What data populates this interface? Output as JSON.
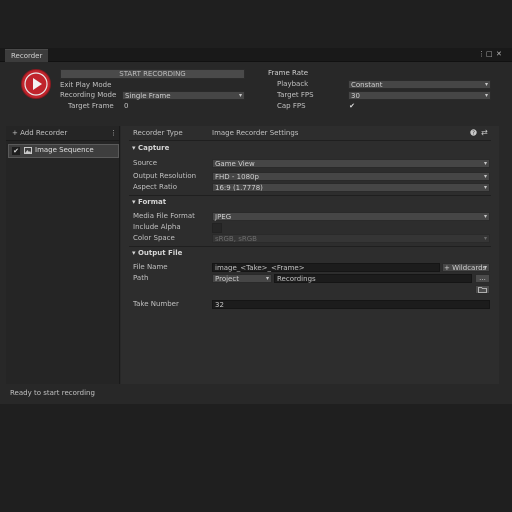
{
  "window": {
    "tab_title": "Recorder",
    "controls": {
      "more": "⋮",
      "maximize": "□",
      "close": "✕"
    }
  },
  "top": {
    "start_button": "START RECORDING",
    "exit_play_mode_label": "Exit Play Mode",
    "recording_mode_label": "Recording Mode",
    "recording_mode_value": "Single Frame",
    "target_frame_label": "Target Frame",
    "target_frame_value": "0",
    "frame_rate_title": "Frame Rate",
    "playback_label": "Playback",
    "playback_value": "Constant",
    "target_fps_label": "Target FPS",
    "target_fps_value": "30",
    "cap_fps_label": "Cap FPS",
    "cap_fps_checked": "✔"
  },
  "sidebar": {
    "add_recorder": "+ Add Recorder",
    "more": "⋮",
    "items": [
      {
        "check": "✔",
        "label": "Image Sequence"
      }
    ]
  },
  "main": {
    "recorder_type_label": "Recorder Type",
    "recorder_type_value": "Image Recorder Settings",
    "capture": {
      "title": "Capture",
      "source_label": "Source",
      "source_value": "Game View",
      "output_resolution_label": "Output Resolution",
      "output_resolution_value": "FHD - 1080p",
      "aspect_ratio_label": "Aspect Ratio",
      "aspect_ratio_value": "16:9 (1.7778)"
    },
    "format": {
      "title": "Format",
      "media_file_format_label": "Media File Format",
      "media_file_format_value": "JPEG",
      "include_alpha_label": "Include Alpha",
      "color_space_label": "Color Space",
      "color_space_value": "sRGB, sRGB"
    },
    "output_file": {
      "title": "Output File",
      "file_name_label": "File Name",
      "file_name_value": "image_<Take>_<Frame>",
      "wildcards_label": "+ Wildcards",
      "path_label": "Path",
      "path_root_value": "Project",
      "path_value": "Recordings",
      "browse_label": "...",
      "take_number_label": "Take Number",
      "take_number_value": "32"
    }
  },
  "status": {
    "text": "Ready to start recording"
  },
  "colors": {
    "record_button": "#c0242c",
    "background": "#282828",
    "panel": "#2d2d2d"
  }
}
